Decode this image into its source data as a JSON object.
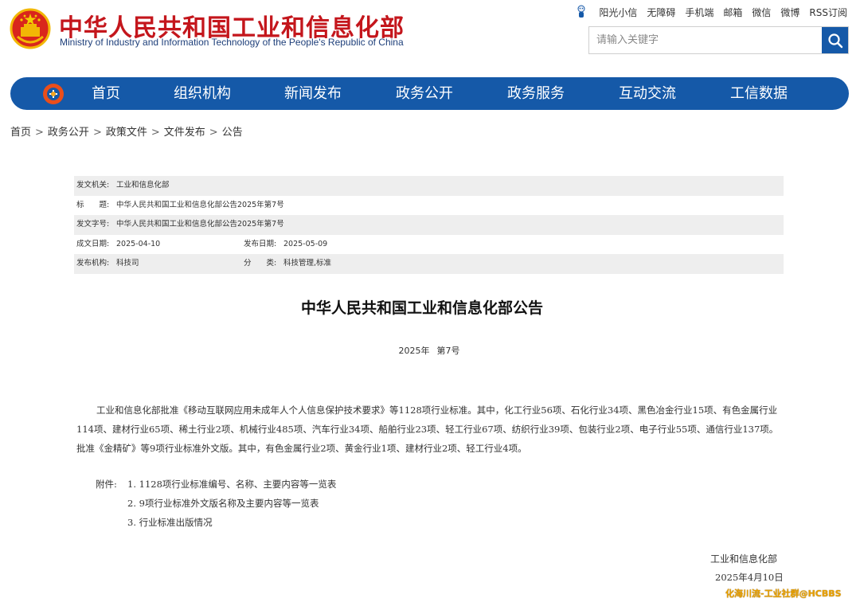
{
  "header": {
    "title": "中华人民共和国工业和信息化部",
    "subtitle": "Ministry of Industry and Information Technology of the People's Republic of China",
    "links": [
      "阳光小信",
      "无障碍",
      "手机端",
      "邮箱",
      "微信",
      "微博",
      "RSS订阅"
    ],
    "search_placeholder": "请输入关键字"
  },
  "nav": {
    "items": [
      "首页",
      "组织机构",
      "新闻发布",
      "政务公开",
      "政务服务",
      "互动交流",
      "工信数据"
    ]
  },
  "breadcrumb": [
    "首页",
    "政务公开",
    "政策文件",
    "文件发布",
    "公告"
  ],
  "meta": {
    "issuer_label": "发文机关:",
    "issuer": "工业和信息化部",
    "title_label": "标　　题:",
    "title": "中华人民共和国工业和信息化部公告2025年第7号",
    "docno_label": "发文字号:",
    "docno": "中华人民共和国工业和信息化部公告2025年第7号",
    "created_label": "成文日期:",
    "created": "2025-04-10",
    "published_label": "发布日期:",
    "published": "2025-05-09",
    "org_label": "发布机构:",
    "org": "科技司",
    "category_label": "分　　类:",
    "category": "科技管理,标准"
  },
  "article": {
    "title": "中华人民共和国工业和信息化部公告",
    "year": "2025年",
    "number": "第7号",
    "body": "工业和信息化部批准《移动互联网应用未成年人个人信息保护技术要求》等1128项行业标准。其中，化工行业56项、石化行业34项、黑色冶金行业15项、有色金属行业114项、建材行业65项、稀土行业2项、机械行业485项、汽车行业34项、船舶行业23项、轻工行业67项、纺织行业39项、包装行业2项、电子行业55项、通信行业137项。批准《金精矿》等9项行业标准外文版。其中，有色金属行业2项、黄金行业1项、建材行业2项、轻工行业4项。",
    "attachments_label": "附件:",
    "attachments": [
      "1. 1128项行业标准编号、名称、主要内容等一览表",
      "2. 9项行业标准外文版名称及主要内容等一览表",
      "3. 行业标准出版情况"
    ],
    "sign_org": "工业和信息化部",
    "sign_date": "2025年4月10日"
  },
  "watermark": "化海川流-工业社群@HCBBS",
  "colors": {
    "brand_red": "#c4161c",
    "nav_blue": "#1559a8",
    "meta_shade": "#eeeeee",
    "watermark": "#e8a000"
  },
  "icons": {
    "emblem": "national-emblem-icon",
    "mascot": "mascot-icon",
    "search": "search-icon",
    "nav_logo": "miit-logo-icon"
  }
}
